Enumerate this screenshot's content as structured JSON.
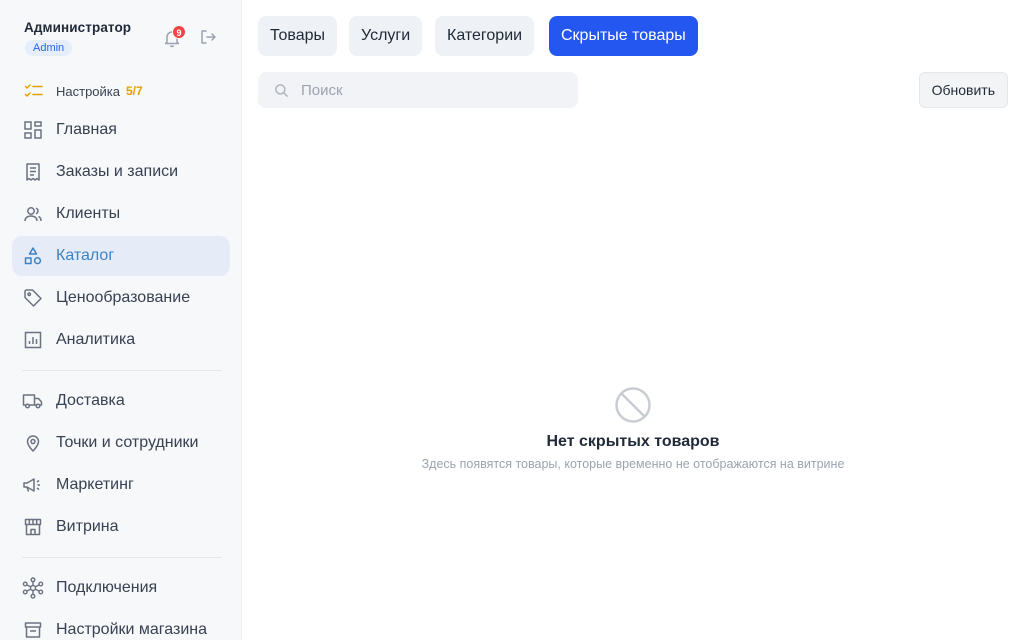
{
  "profile": {
    "name": "Администратор",
    "role": "Admin",
    "notifications": "9"
  },
  "setup": {
    "label": "Настройка",
    "progress": "5/7"
  },
  "sidebar": {
    "items": [
      {
        "label": "Главная",
        "icon": "grid-icon"
      },
      {
        "label": "Заказы и записи",
        "icon": "receipt-icon"
      },
      {
        "label": "Клиенты",
        "icon": "users-icon"
      },
      {
        "label": "Каталог",
        "icon": "shapes-icon",
        "active": true
      },
      {
        "label": "Ценообразование",
        "icon": "tag-icon"
      },
      {
        "label": "Аналитика",
        "icon": "chart-icon"
      },
      {
        "label": "Доставка",
        "icon": "truck-icon"
      },
      {
        "label": "Точки и сотрудники",
        "icon": "map-pin-icon"
      },
      {
        "label": "Маркетинг",
        "icon": "megaphone-icon"
      },
      {
        "label": "Витрина",
        "icon": "storefront-icon"
      },
      {
        "label": "Подключения",
        "icon": "network-icon"
      },
      {
        "label": "Настройки магазина",
        "icon": "store-settings-icon"
      }
    ]
  },
  "tabs": [
    {
      "label": "Товары"
    },
    {
      "label": "Услуги"
    },
    {
      "label": "Категории"
    },
    {
      "label": "Скрытые товары",
      "active": true
    }
  ],
  "search": {
    "placeholder": "Поиск",
    "value": ""
  },
  "toolbar": {
    "refresh_label": "Обновить"
  },
  "empty_state": {
    "title": "Нет скрытых товаров",
    "subtitle": "Здесь появятся товары, которые временно не отображаются на витрине",
    "icon": "prohibited-icon"
  },
  "colors": {
    "accent": "#2457f0",
    "active_nav_bg": "#e5ecf7",
    "active_nav_text": "#3b82c4",
    "badge": "#ef4444",
    "setup_progress": "#e0a100"
  }
}
